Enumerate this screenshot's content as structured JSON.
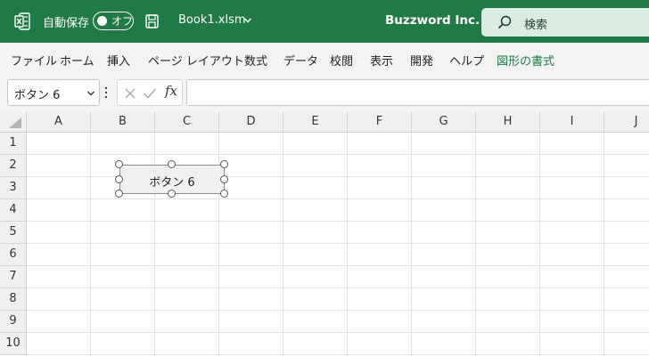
{
  "titlebar": {
    "app_icon": "excel-icon",
    "autosave_label": "自動保存",
    "autosave_toggle": "オフ",
    "save_icon": "save-icon",
    "filename": "Book1.xlsm",
    "company": "Buzzword Inc.",
    "search_placeholder": "検索"
  },
  "ribbon": {
    "tabs": [
      "ファイル",
      "ホーム",
      "挿入",
      "ページ レイアウト",
      "数式",
      "データ",
      "校閲",
      "表示",
      "開発",
      "ヘルプ",
      "図形の書式"
    ],
    "active_tab": "図形の書式"
  },
  "formula_bar": {
    "name_box": "ボタン 6",
    "fx_label": "fx",
    "formula": ""
  },
  "grid": {
    "columns": [
      "A",
      "B",
      "C",
      "D",
      "E",
      "F",
      "G",
      "H",
      "I",
      "J"
    ],
    "rows": [
      "1",
      "2",
      "3",
      "4",
      "5",
      "6",
      "7",
      "8",
      "9",
      "10"
    ]
  },
  "shape_button": {
    "label": "ボタン 6",
    "selected": true
  },
  "colors": {
    "titlebar_bg": "#1f7a44",
    "accent_green": "#1e7a44",
    "ribbon_bg": "#f3f3f3",
    "header_bg": "#f0f0f0",
    "gridline": "#e2e2e2"
  }
}
